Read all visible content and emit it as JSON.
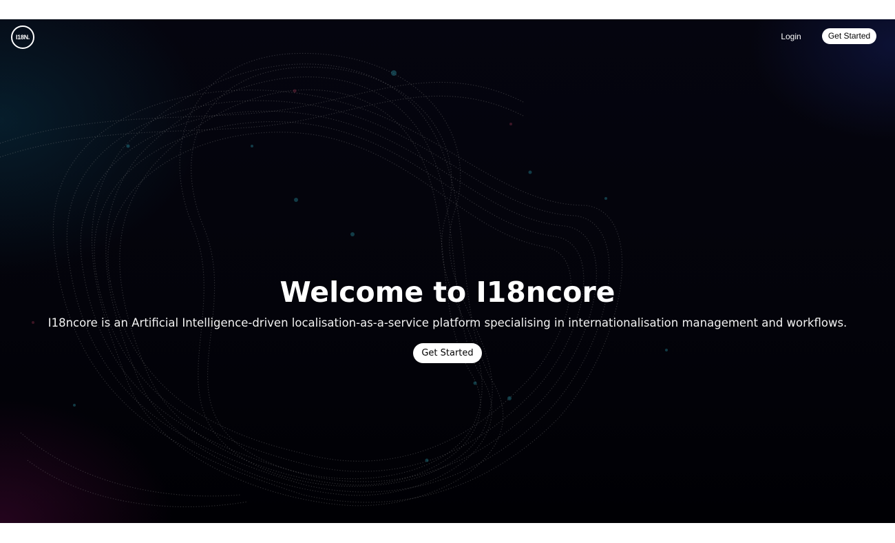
{
  "header": {
    "logo_text": "I18N.",
    "login_label": "Login",
    "get_started_label": "Get Started"
  },
  "hero": {
    "title": "Welcome to I18ncore",
    "description": "I18ncore is an Artificial Intelligence-driven localisation-as-a-service platform specialising in internationalisation management and workflows.",
    "cta_label": "Get Started"
  },
  "colors": {
    "background": "#03030a",
    "text": "#ffffff",
    "button_bg": "#ffffff",
    "button_text": "#000000"
  }
}
